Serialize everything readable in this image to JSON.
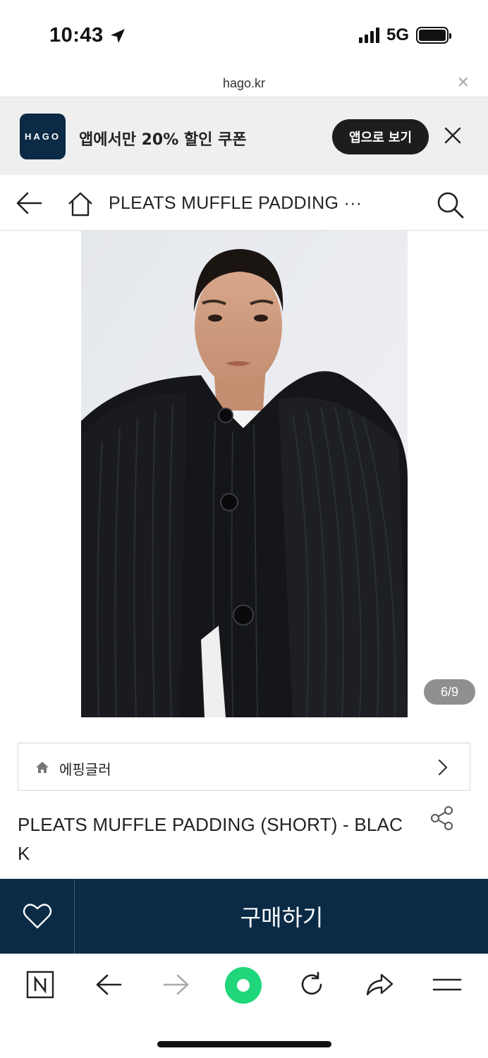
{
  "status_bar": {
    "time": "10:43",
    "network": "5G"
  },
  "url_bar": {
    "domain": "hago.kr"
  },
  "app_banner": {
    "logo_text": "HAGO",
    "message": "앱에서만 20% 할인 쿠폰",
    "open_app_label": "앱으로 보기"
  },
  "header": {
    "title": "PLEATS MUFFLE PADDING ···"
  },
  "gallery": {
    "counter": "6/9"
  },
  "brand": {
    "name": "에핑글러"
  },
  "product": {
    "title": "PLEATS MUFFLE PADDING (SHORT) - BLACK"
  },
  "purchase": {
    "buy_label": "구매하기"
  },
  "colors": {
    "navy": "#0b2a45",
    "banner_bg": "#efefef",
    "green": "#1fd67a"
  },
  "icons": [
    "location-arrow-icon",
    "signal-icon",
    "battery-icon",
    "close-icon",
    "back-arrow-icon",
    "home-icon",
    "search-icon",
    "chevron-right-icon",
    "share-icon",
    "heart-icon",
    "naver-n-icon",
    "forward-arrow-icon",
    "green-circle-icon",
    "reload-icon",
    "share-arrow-icon",
    "menu-icon"
  ]
}
